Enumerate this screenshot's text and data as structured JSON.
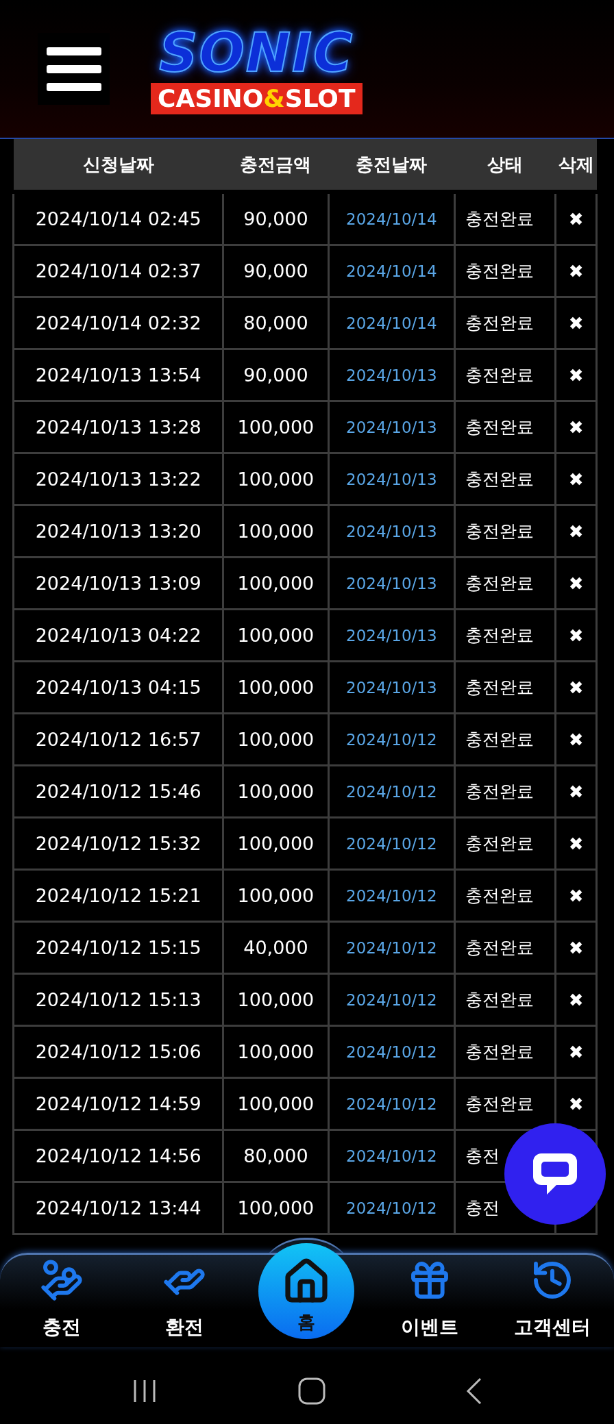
{
  "header": {
    "logo": {
      "title": "SONIC",
      "subtitle": [
        {
          "text": "CASINO",
          "color": "#ffffff"
        },
        {
          "text": "&",
          "color": "#ffd400"
        },
        {
          "text": "SLOT",
          "color": "#ffffff"
        }
      ]
    }
  },
  "table": {
    "columns": [
      "신청날짜",
      "충전금액",
      "충전날짜",
      "상태",
      "삭제"
    ],
    "rows": [
      {
        "requested": "2024/10/14 02:45",
        "amount": "90,000",
        "date": "2024/10/14",
        "status": "충전완료",
        "delete": "✖"
      },
      {
        "requested": "2024/10/14 02:37",
        "amount": "90,000",
        "date": "2024/10/14",
        "status": "충전완료",
        "delete": "✖"
      },
      {
        "requested": "2024/10/14 02:32",
        "amount": "80,000",
        "date": "2024/10/14",
        "status": "충전완료",
        "delete": "✖"
      },
      {
        "requested": "2024/10/13 13:54",
        "amount": "90,000",
        "date": "2024/10/13",
        "status": "충전완료",
        "delete": "✖"
      },
      {
        "requested": "2024/10/13 13:28",
        "amount": "100,000",
        "date": "2024/10/13",
        "status": "충전완료",
        "delete": "✖"
      },
      {
        "requested": "2024/10/13 13:22",
        "amount": "100,000",
        "date": "2024/10/13",
        "status": "충전완료",
        "delete": "✖"
      },
      {
        "requested": "2024/10/13 13:20",
        "amount": "100,000",
        "date": "2024/10/13",
        "status": "충전완료",
        "delete": "✖"
      },
      {
        "requested": "2024/10/13 13:09",
        "amount": "100,000",
        "date": "2024/10/13",
        "status": "충전완료",
        "delete": "✖"
      },
      {
        "requested": "2024/10/13 04:22",
        "amount": "100,000",
        "date": "2024/10/13",
        "status": "충전완료",
        "delete": "✖"
      },
      {
        "requested": "2024/10/13 04:15",
        "amount": "100,000",
        "date": "2024/10/13",
        "status": "충전완료",
        "delete": "✖"
      },
      {
        "requested": "2024/10/12 16:57",
        "amount": "100,000",
        "date": "2024/10/12",
        "status": "충전완료",
        "delete": "✖"
      },
      {
        "requested": "2024/10/12 15:46",
        "amount": "100,000",
        "date": "2024/10/12",
        "status": "충전완료",
        "delete": "✖"
      },
      {
        "requested": "2024/10/12 15:32",
        "amount": "100,000",
        "date": "2024/10/12",
        "status": "충전완료",
        "delete": "✖"
      },
      {
        "requested": "2024/10/12 15:21",
        "amount": "100,000",
        "date": "2024/10/12",
        "status": "충전완료",
        "delete": "✖"
      },
      {
        "requested": "2024/10/12 15:15",
        "amount": "40,000",
        "date": "2024/10/12",
        "status": "충전완료",
        "delete": "✖"
      },
      {
        "requested": "2024/10/12 15:13",
        "amount": "100,000",
        "date": "2024/10/12",
        "status": "충전완료",
        "delete": "✖"
      },
      {
        "requested": "2024/10/12 15:06",
        "amount": "100,000",
        "date": "2024/10/12",
        "status": "충전완료",
        "delete": "✖"
      },
      {
        "requested": "2024/10/12 14:59",
        "amount": "100,000",
        "date": "2024/10/12",
        "status": "충전완료",
        "delete": "✖"
      },
      {
        "requested": "2024/10/12 14:56",
        "amount": "80,000",
        "date": "2024/10/12",
        "status": "충전"
      },
      {
        "requested": "2024/10/12 13:44",
        "amount": "100,000",
        "date": "2024/10/12",
        "status": "충전"
      }
    ]
  },
  "bottom_nav": [
    {
      "label": "충전",
      "kind": "deposit",
      "selected": false
    },
    {
      "label": "환전",
      "kind": "withdraw",
      "selected": false
    },
    {
      "label": "홈",
      "kind": "home",
      "selected": true
    },
    {
      "label": "이벤트",
      "kind": "event",
      "selected": false
    },
    {
      "label": "고객센터",
      "kind": "support",
      "selected": false
    }
  ]
}
